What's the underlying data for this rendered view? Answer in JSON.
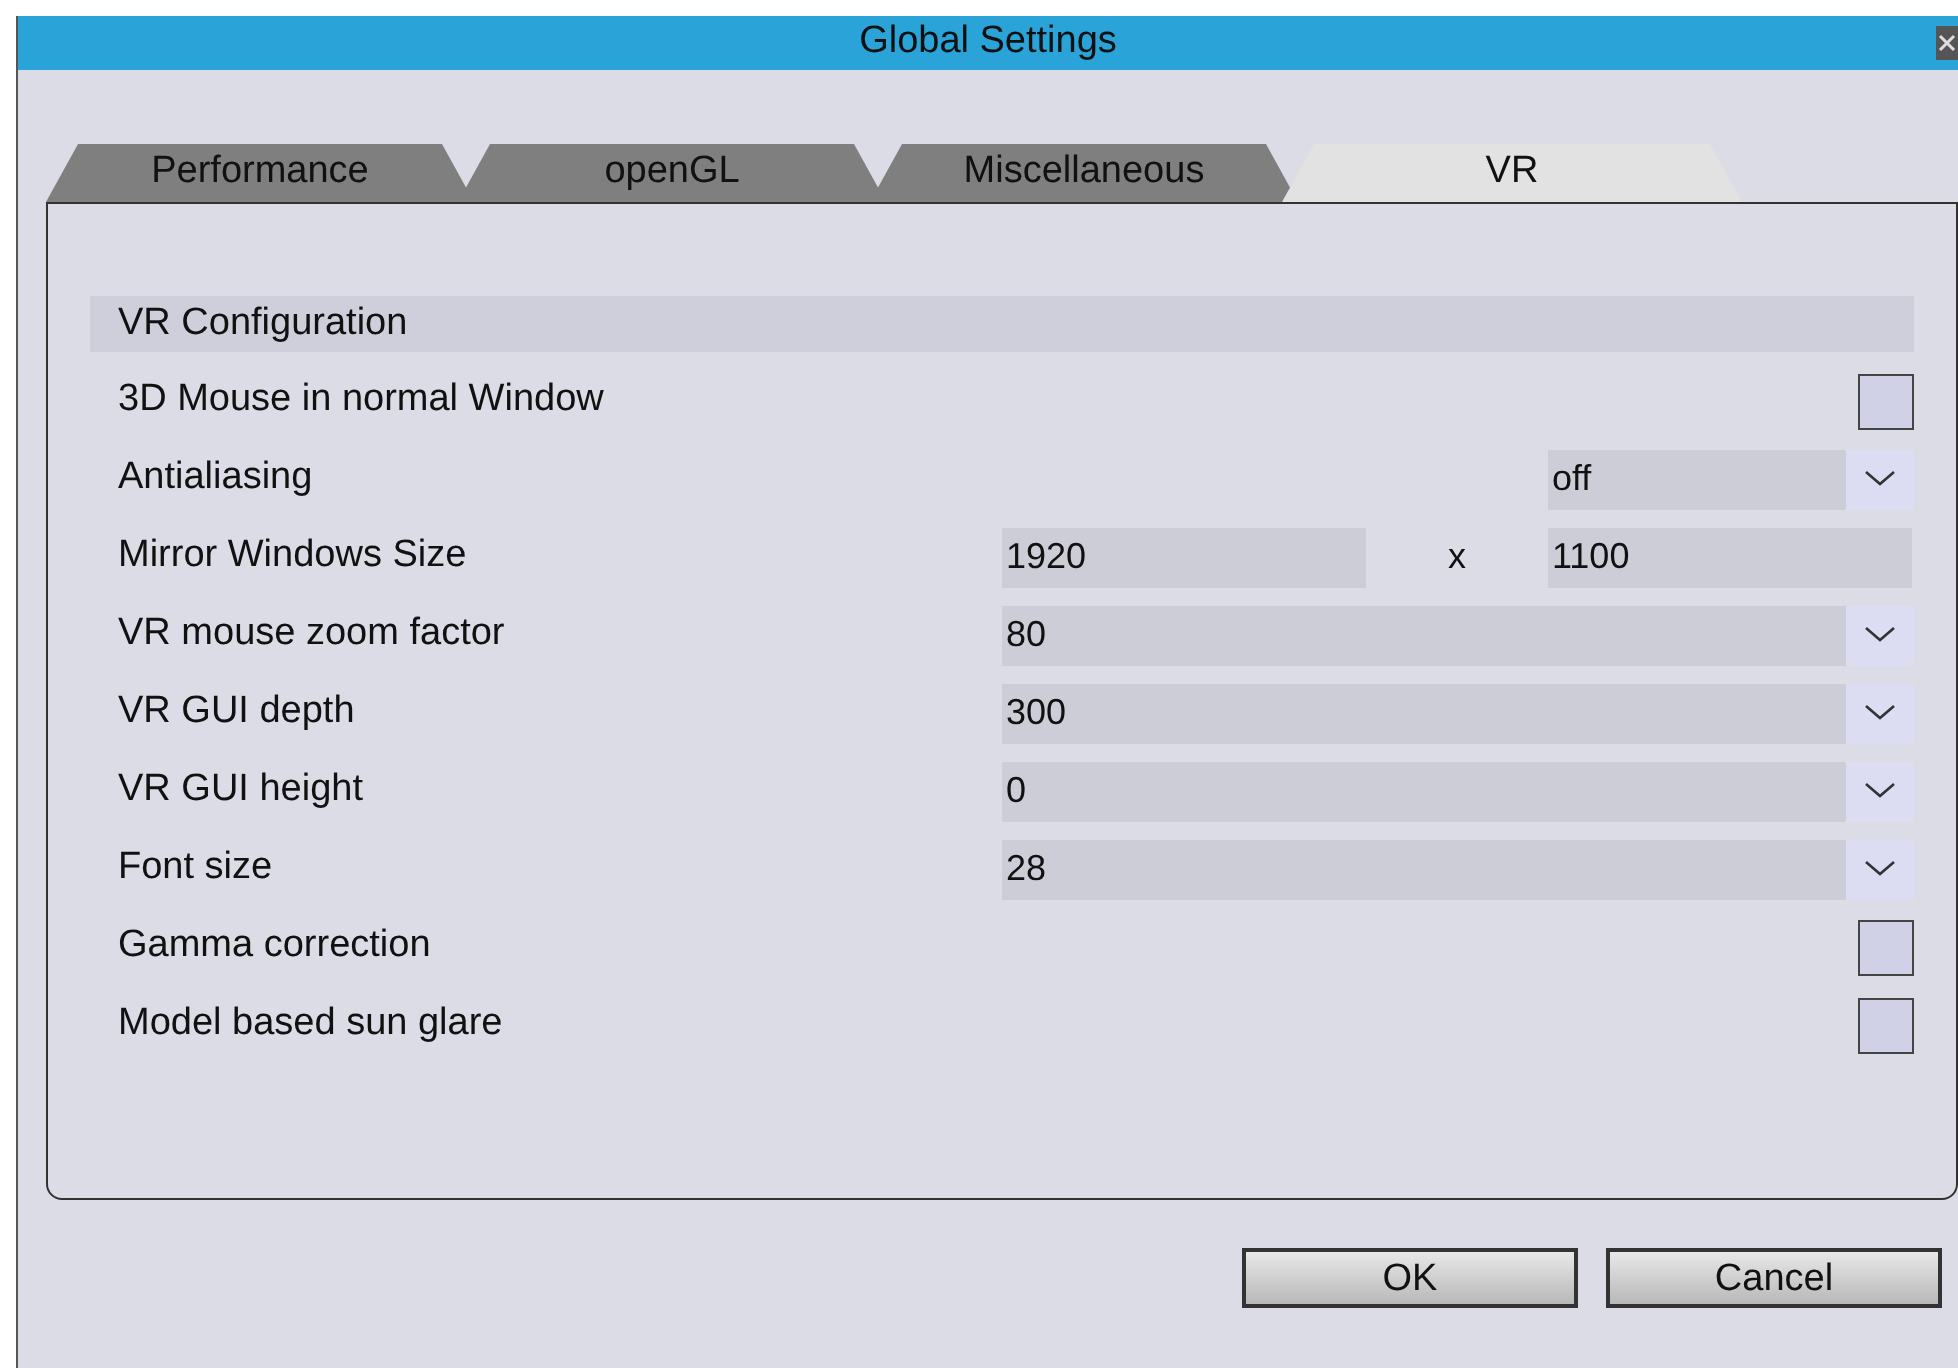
{
  "window": {
    "title": "Global Settings"
  },
  "tabs": [
    {
      "label": "Performance",
      "selected": false
    },
    {
      "label": "openGL",
      "selected": false
    },
    {
      "label": "Miscellaneous",
      "selected": false
    },
    {
      "label": "VR",
      "selected": true
    }
  ],
  "section": {
    "title": "VR Configuration"
  },
  "rows": [
    {
      "kind": "checkbox",
      "label": "3D Mouse in normal Window",
      "checked": false
    },
    {
      "kind": "select_narrow",
      "label": "Antialiasing",
      "value": "off"
    },
    {
      "kind": "pair",
      "label": "Mirror Windows Size",
      "value": "1920",
      "separator": "x",
      "value_2": "1100"
    },
    {
      "kind": "select",
      "label": "VR mouse zoom factor",
      "value": "80"
    },
    {
      "kind": "select",
      "label": "VR GUI depth",
      "value": "300"
    },
    {
      "kind": "select",
      "label": "VR GUI height",
      "value": "0"
    },
    {
      "kind": "select",
      "label": "Font size",
      "value": "28"
    },
    {
      "kind": "checkbox",
      "label": "Gamma correction",
      "checked": false
    },
    {
      "kind": "checkbox",
      "label": "Model based sun glare",
      "checked": false
    }
  ],
  "buttons": [
    "OK",
    "Cancel"
  ]
}
